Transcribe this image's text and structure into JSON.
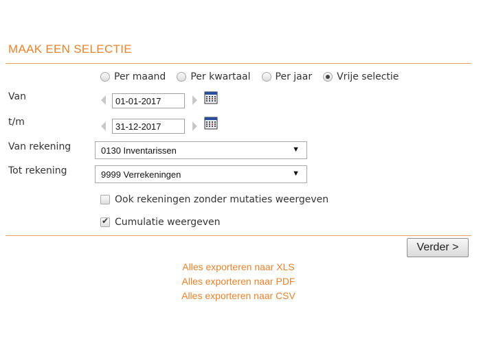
{
  "header": {
    "title": "MAAK EEN SELECTIE"
  },
  "period_options": [
    {
      "label": "Per maand",
      "checked": false
    },
    {
      "label": "Per kwartaal",
      "checked": false
    },
    {
      "label": "Per jaar",
      "checked": false
    },
    {
      "label": "Vrije selectie",
      "checked": true
    }
  ],
  "from_date": {
    "label": "Van",
    "value": "01-01-2017"
  },
  "to_date": {
    "label": "t/m",
    "value": "31-12-2017"
  },
  "from_account": {
    "label": "Van rekening",
    "value": "0130 Inventarissen"
  },
  "to_account": {
    "label": "Tot rekening",
    "value": "9999 Verrekeningen"
  },
  "options": {
    "include_no_mutations": {
      "label": "Ook rekeningen zonder mutaties weergeven",
      "checked": false
    },
    "cumulative": {
      "label": "Cumulatie weergeven",
      "checked": true
    }
  },
  "next_button": {
    "label": "Verder >"
  },
  "exports": {
    "xls": "Alles exporteren naar XLS",
    "pdf": "Alles exporteren naar PDF",
    "csv": "Alles exporteren naar CSV"
  },
  "colors": {
    "accent": "#e8822e"
  }
}
